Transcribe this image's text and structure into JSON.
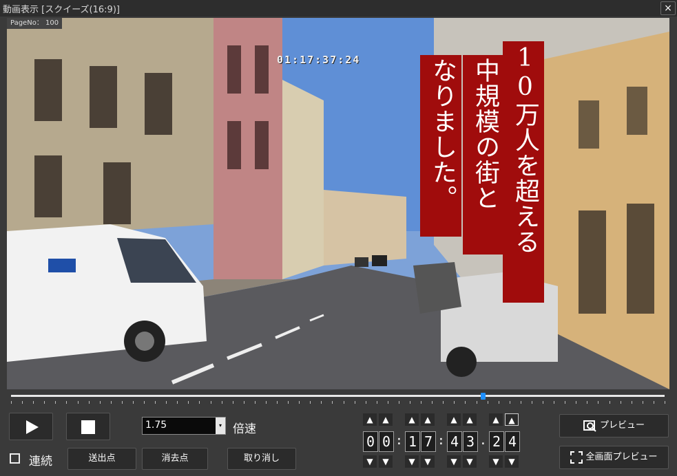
{
  "window": {
    "title": "動画表示 [スクイーズ(16:9)]",
    "close_label": "×"
  },
  "video": {
    "page_no": "PageNo： 100",
    "timecode_overlay": "01:17:37:24",
    "caption_columns": [
      "10万人を超える",
      "中規模の街と",
      "なりました。"
    ]
  },
  "seek": {
    "progress": 0.722
  },
  "controls": {
    "speed_value": "1.75",
    "speed_unit": "倍速",
    "continuous_label": "連続",
    "send_point_label": "送出点",
    "delete_point_label": "消去点",
    "cancel_label": "取り消し",
    "up_arrow": "▲",
    "down_arrow": "▼",
    "dropdown_arrow": "▾"
  },
  "timecode": {
    "digits": [
      "0",
      "0",
      "1",
      "7",
      "4",
      "3",
      "2",
      "4"
    ],
    "separators": [
      ":",
      ":",
      "."
    ]
  },
  "preview": {
    "preview_label": "プレビュー",
    "fullscreen_label": "全画面プレビュー"
  },
  "colors": {
    "caption_bg": "#a00c0c",
    "seek_thumb": "#1e90ff",
    "window_bg": "#3a3a3a"
  }
}
